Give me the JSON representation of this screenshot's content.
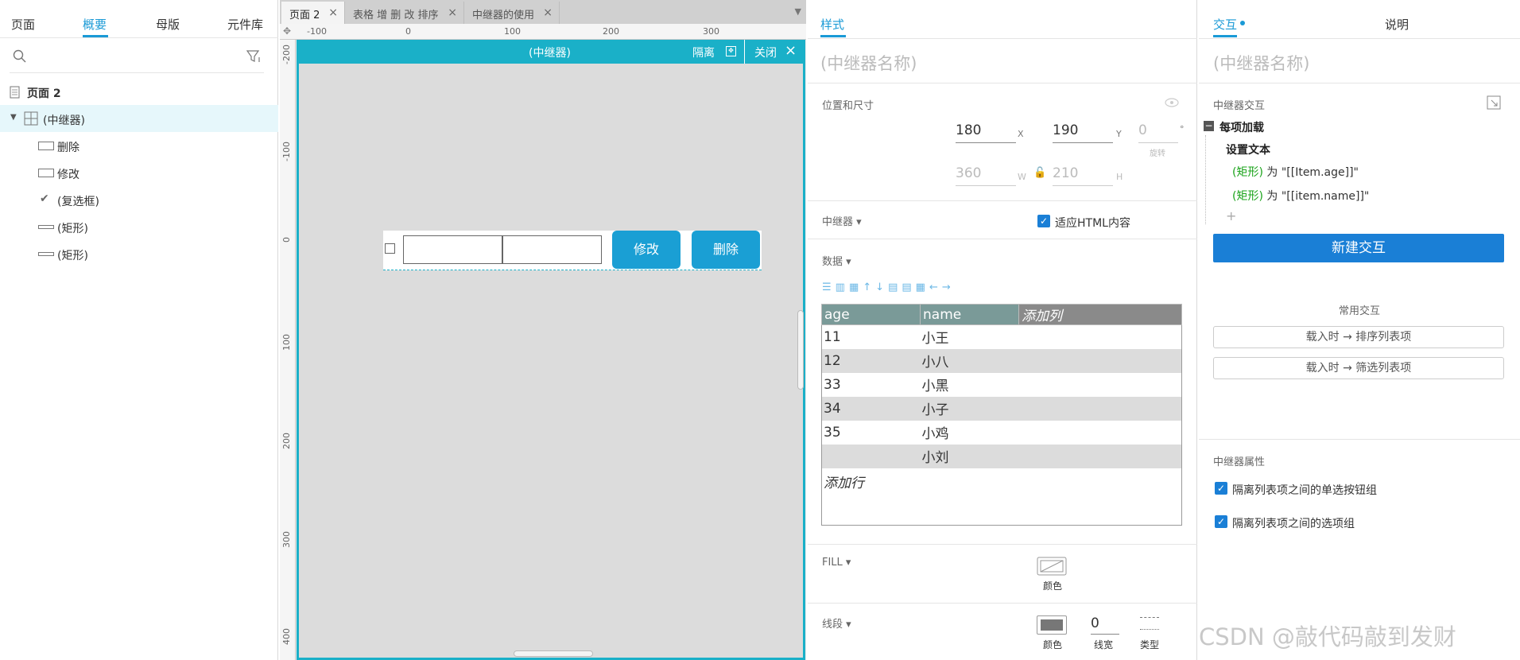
{
  "left_panel": {
    "tabs": [
      "页面",
      "概要",
      "母版",
      "元件库"
    ],
    "active_tab": "概要",
    "tree": {
      "page": "页面 2",
      "repeater": "(中继器)",
      "children": [
        "删除",
        "修改",
        "(复选框)",
        "(矩形)",
        "(矩形)"
      ]
    }
  },
  "canvas": {
    "doc_tabs": [
      "页面 2",
      "表格 增 删 改 排序",
      "中继器的使用"
    ],
    "ruler_top": [
      "-100",
      "0",
      "100",
      "200",
      "300"
    ],
    "ruler_left": [
      "-200",
      "-100",
      "0",
      "100",
      "200",
      "300",
      "400"
    ],
    "editor_title": "(中继器)",
    "isolate_label": "隔离",
    "close_label": "关闭",
    "edit_button": "修改",
    "delete_button": "删除"
  },
  "style_panel": {
    "tab": "样式",
    "name_placeholder": "(中继器名称)",
    "position_size": "位置和尺寸",
    "x": "180",
    "x_label": "X",
    "y": "190",
    "y_label": "Y",
    "rotation": "0",
    "rotation_unit": "°",
    "rotation_label": "旋转",
    "w": "360",
    "w_label": "W",
    "h": "210",
    "h_label": "H",
    "repeater_label": "中继器",
    "fit_html": "适应HTML内容",
    "data_label": "数据",
    "columns": [
      "age",
      "name",
      "添加列"
    ],
    "rows": [
      {
        "age": "11",
        "name": "小王"
      },
      {
        "age": "12",
        "name": "小八"
      },
      {
        "age": "33",
        "name": "小黑"
      },
      {
        "age": "34",
        "name": "小子"
      },
      {
        "age": "35",
        "name": "小鸡"
      },
      {
        "age": "",
        "name": "小刘"
      }
    ],
    "add_row": "添加行",
    "fill_label": "FILL",
    "fill_color": "颜色",
    "stroke_label": "线段",
    "stroke_color": "颜色",
    "stroke_width": "0",
    "stroke_width_label": "线宽",
    "stroke_type": "类型"
  },
  "interaction_panel": {
    "tab_interaction": "交互",
    "tab_notes": "说明",
    "name_placeholder": "(中继器名称)",
    "repeater_interaction": "中继器交互",
    "event": "每项加载",
    "action": "设置文本",
    "case1_target": "(矩形)",
    "case1_text": "为 \"[[Item.age]]\"",
    "case2_target": "(矩形)",
    "case2_text": "为 \"[[item.name]]\"",
    "plus": "+",
    "new_interaction": "新建交互",
    "common": "常用交互",
    "common_items": [
      "载入时 → 排序列表项",
      "载入时 → 筛选列表项"
    ],
    "properties": "中继器属性",
    "prop1": "隔离列表项之间的单选按钮组",
    "prop2": "隔离列表项之间的选项组"
  },
  "watermark": "CSDN @敲代码敲到发财",
  "colors": {
    "accent": "#1a9ad6",
    "editor": "#1ab0c8",
    "primary_button": "#1a7fd6",
    "cell_button": "#1a9fd4"
  }
}
